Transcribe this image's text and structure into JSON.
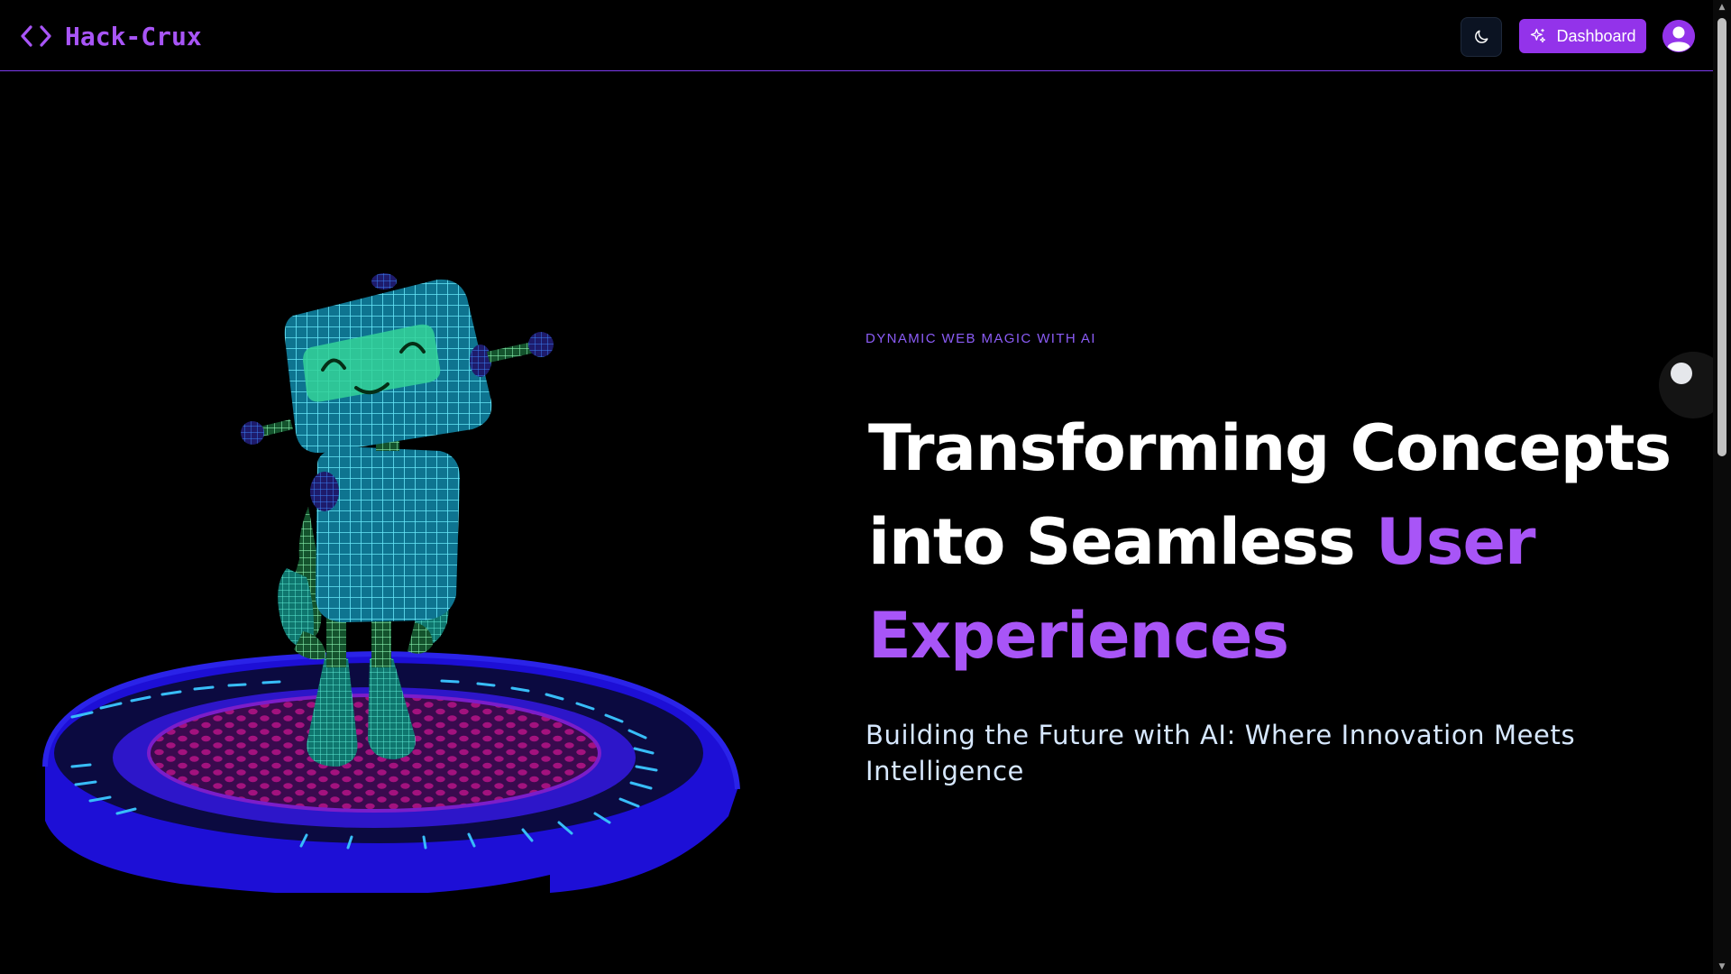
{
  "header": {
    "brand_name": "Hack-Crux",
    "brand_icon": "code-brackets-icon",
    "theme_toggle_icon": "moon-icon",
    "dashboard_label": "Dashboard",
    "dashboard_icon": "sparkles-icon",
    "avatar_icon": "user-avatar-icon"
  },
  "hero": {
    "eyebrow": "DYNAMIC WEB MAGIC WITH AI",
    "headline_white": "Transforming Concepts into Seamless ",
    "headline_accent": "User Experiences",
    "subheadline": "Building the Future with AI: Where Innovation Meets Intelligence",
    "illustration": "wireframe-robot-on-platform"
  },
  "colors": {
    "background": "#000000",
    "accent": "#a855f7",
    "button": "#9333ea",
    "header_border": "#7c3aed",
    "robot_mesh": "#22d3ee",
    "platform": "#1d0fd6"
  }
}
